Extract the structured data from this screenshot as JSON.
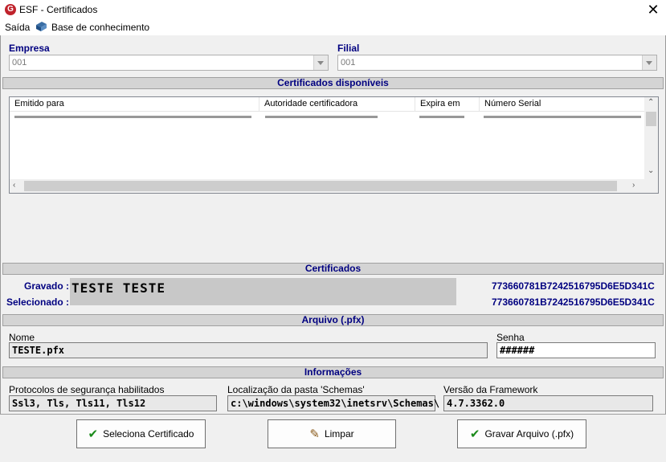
{
  "window": {
    "title": "ESF - Certificados",
    "logo_letter": "G"
  },
  "menu": {
    "items": [
      "Saída",
      "Base de conhecimento"
    ]
  },
  "empresa": {
    "label": "Empresa",
    "value": "001"
  },
  "filial": {
    "label": "Filial",
    "value": "001"
  },
  "sections": {
    "disponiveis": "Certificados disponíveis",
    "certificados": "Certificados",
    "arquivo": "Arquivo (.pfx)",
    "informacoes": "Informações"
  },
  "listview": {
    "columns": [
      "Emitido para",
      "Autoridade certificadora",
      "Expira em",
      "Número Serial"
    ]
  },
  "certificados": {
    "gravado_label": "Gravado :",
    "selecionado_label": "Selecionado :",
    "name": "TESTE  TESTE",
    "gravado_serial": "773660781B7242516795D6E5D341C",
    "selecionado_serial": "773660781B7242516795D6E5D341C"
  },
  "arquivo": {
    "nome_label": "Nome",
    "nome_value": "TESTE.pfx",
    "senha_label": "Senha",
    "senha_value": "######"
  },
  "informacoes": {
    "protocolos_label": "Protocolos de segurança habilitados",
    "protocolos_value": "Ssl3, Tls, Tls11, Tls12",
    "localizacao_label": "Localização da pasta 'Schemas'",
    "localizacao_value": "c:\\windows\\system32\\inetsrv\\Schemas\\",
    "versao_label": "Versão da Framework",
    "versao_value": "4.7.3362.0"
  },
  "buttons": {
    "seleciona": "Seleciona Certificado",
    "limpar": "Limpar",
    "gravar": "Gravar Arquivo (.pfx)"
  },
  "icons": {
    "check": "check-icon",
    "broom": "broom-icon",
    "book": "book-icon"
  }
}
